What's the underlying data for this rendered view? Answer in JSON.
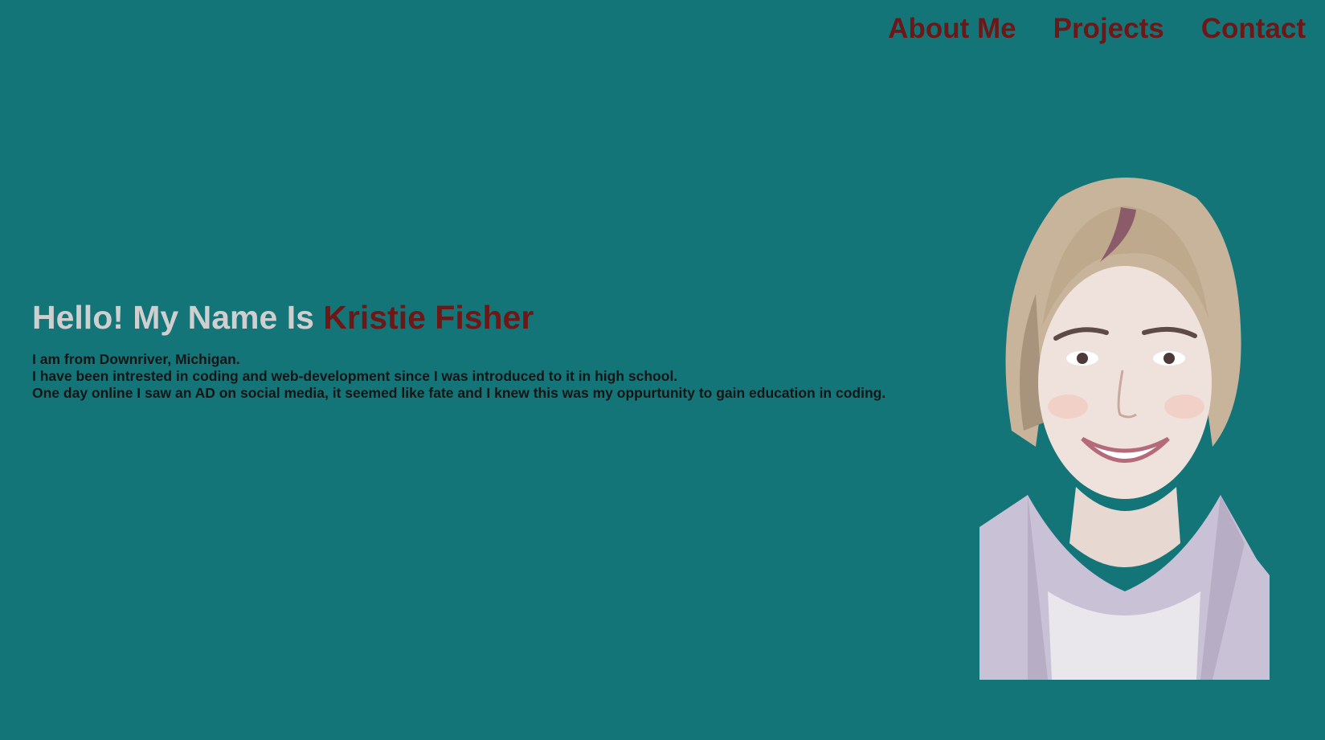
{
  "nav": {
    "items": [
      {
        "label": "About Me"
      },
      {
        "label": "Projects"
      },
      {
        "label": "Contact"
      }
    ]
  },
  "hero": {
    "greeting": "Hello! My Name Is ",
    "name": "Kristie Fisher",
    "bio": [
      "I am from Downriver, Michigan.",
      "I have been intrested in coding and web-development since I was introduced to it in high school.",
      "One day online I saw an AD on social media, it seemed like fate and I knew this was my oppurtunity to gain education in coding."
    ]
  },
  "portrait": {
    "icon": "portrait-photo"
  },
  "colors": {
    "background": "#147578",
    "accent": "#6e1717",
    "heading": "#cfcfcf",
    "text": "#151515"
  }
}
